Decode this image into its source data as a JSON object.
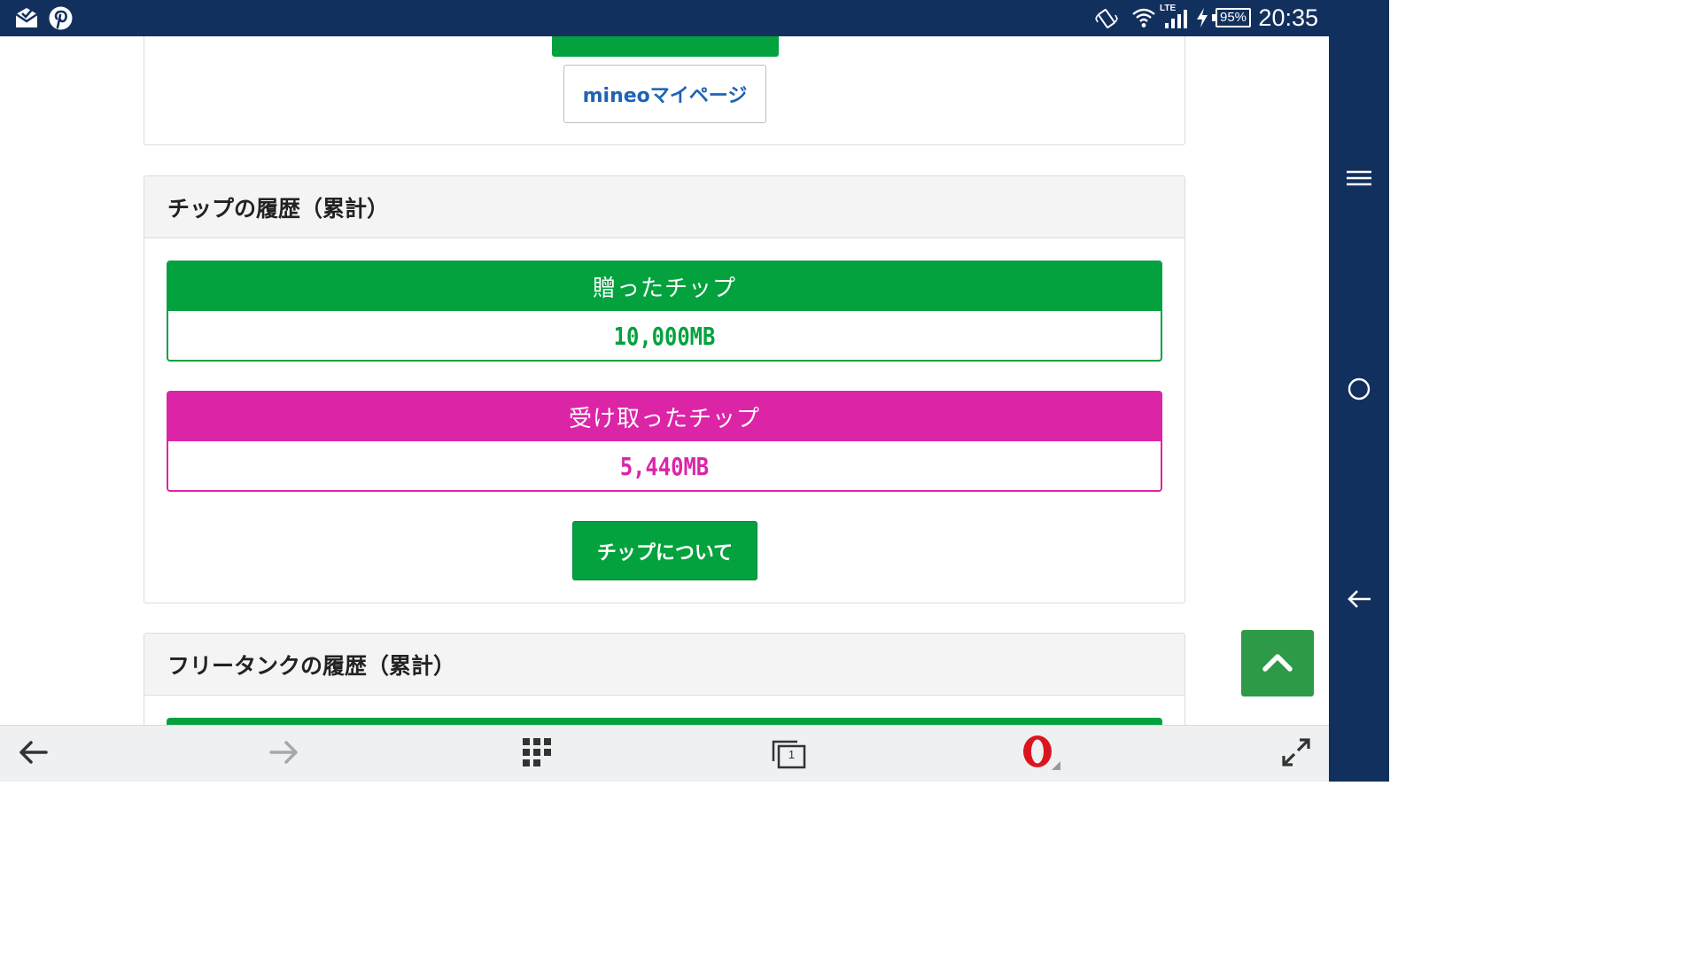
{
  "status_bar": {
    "time": "20:35",
    "battery": "95%",
    "network": "LTE",
    "icons": [
      "mail-icon",
      "pinterest-icon",
      "vibrate-icon",
      "wifi-icon",
      "signal-icon",
      "charging-icon"
    ]
  },
  "section_top": {
    "mypage_button": "mineoマイページ"
  },
  "tips_section": {
    "title": "チップの履歴（累計）",
    "sent_label": "贈ったチップ",
    "sent_value": "10,000MB",
    "received_label": "受け取ったチップ",
    "received_value": "5,440MB",
    "about_button": "チップについて"
  },
  "free_tank_section": {
    "title": "フリータンクの履歴（累計）"
  },
  "toolbar": {
    "tab_count": "1",
    "icons": [
      "back-arrow-icon",
      "forward-arrow-icon",
      "speed-dial-icon",
      "tabs-icon",
      "opera-menu-icon",
      "fullscreen-icon"
    ]
  },
  "nav_bar": {
    "icons": [
      "menu-icon",
      "home-icon",
      "back-icon"
    ]
  },
  "colors": {
    "green": "#03a23e",
    "magenta": "#dc24a7",
    "link_blue": "#1e64b4",
    "status_bar": "#12305e"
  }
}
